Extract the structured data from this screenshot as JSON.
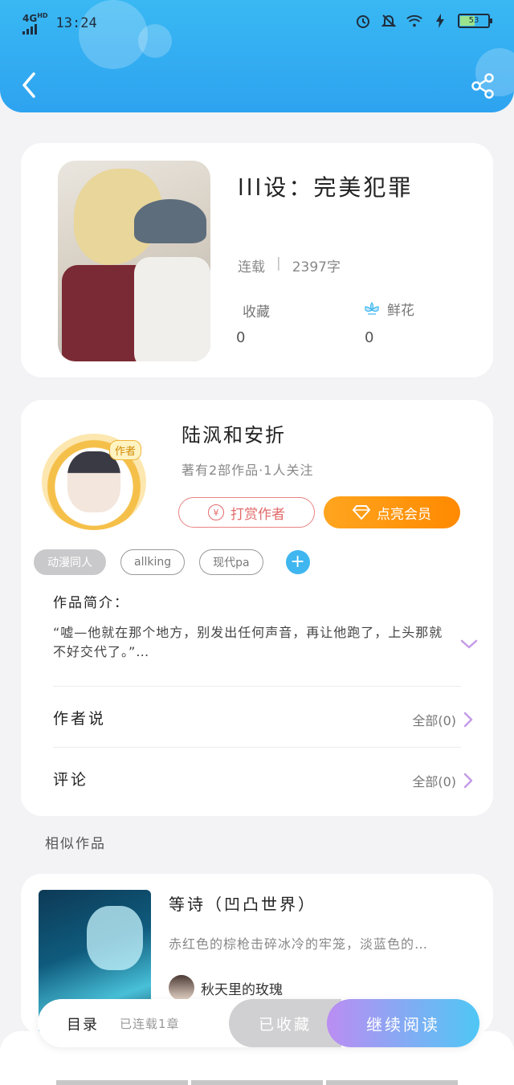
{
  "status_bar": {
    "network": "4G",
    "network_sup": "HD",
    "time": "13:24",
    "battery": "53",
    "battery_level": 0.53
  },
  "work": {
    "title": "lll设：完美犯罪",
    "status": "连载",
    "word_count": "2397字",
    "collect_label": "收藏",
    "collect_count": "0",
    "flower_label": "鲜花",
    "flower_count": "0"
  },
  "author": {
    "name": "陆沨和安折",
    "meta": "著有2部作品·1人关注",
    "badge": "作者",
    "tip_button": "打赏作者",
    "tip_icon": "¥",
    "vip_button": "点亮会员"
  },
  "tags": [
    "动漫同人",
    "allking",
    "现代pa"
  ],
  "tag_add": "+",
  "intro": {
    "label": "作品简介：",
    "text": "“嘘—他就在那个地方，别发出任何声音，再让他跑了，上头那就不好交代了。”…"
  },
  "rows": {
    "author_says": {
      "label": "作者说",
      "value": "全部(0)"
    },
    "comments": {
      "label": "评论",
      "value": "全部(0)"
    }
  },
  "similar": {
    "label": "相似作品",
    "items": [
      {
        "title": "等诗（凹凸世界）",
        "desc": "赤红色的棕枪击碎冰冷的牢笼，淡蓝色的…",
        "author": "秋天里的玫瑰"
      }
    ]
  },
  "bottom_bar": {
    "toc_label": "目录",
    "toc_status": "已连载1章",
    "fav_button": "已收藏",
    "read_button": "继续阅读"
  },
  "colors": {
    "header": "#2ea3f0",
    "vip": "#ff8a00",
    "tip": "#e26b6b",
    "accent": "#3fb6f0"
  },
  "icons": [
    "back-icon",
    "share-icon",
    "alarm-icon",
    "mute-icon",
    "wifi-icon",
    "charge-icon",
    "flower-icon",
    "yen-icon",
    "diamond-icon",
    "chevron-down-icon",
    "chevron-right-icon"
  ]
}
